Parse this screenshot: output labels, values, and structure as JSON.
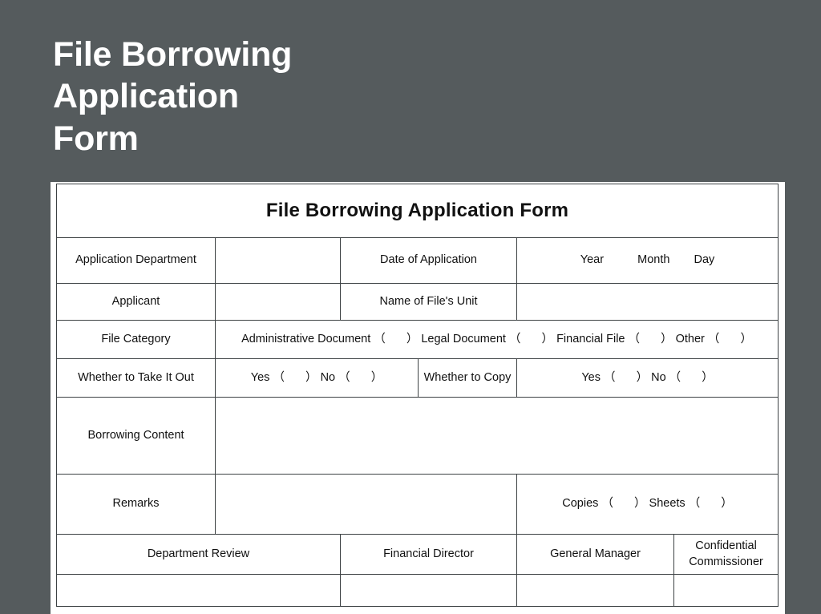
{
  "slide": {
    "heading": "File Borrowing\nApplication\nForm",
    "background_color": "#555b5d",
    "heading_color": "#ffffff"
  },
  "form": {
    "title": "File Borrowing Application Form",
    "rows": {
      "application_department": {
        "label": "Application Department",
        "value": "",
        "date_label": "Date of Application",
        "date_year": "Year",
        "date_month": "Month",
        "date_day": "Day"
      },
      "applicant": {
        "label": "Applicant",
        "value": "",
        "unit_label": "Name of File's Unit",
        "unit_value": ""
      },
      "file_category": {
        "label": "File Category",
        "option_1": "Administrative Document",
        "option_2": "Legal Document",
        "option_3": "Financial File",
        "option_4": "Other",
        "paren_open": "（",
        "paren_close": "）"
      },
      "take_it_out": {
        "label": "Whether to Take It Out",
        "yes": "Yes",
        "no": "No",
        "paren_open": "（",
        "paren_close": "）"
      },
      "copy": {
        "label": "Whether to Copy",
        "yes": "Yes",
        "no": "No",
        "paren_open": "（",
        "paren_close": "）"
      },
      "borrowing_content": {
        "label": "Borrowing Content",
        "value": ""
      },
      "remarks": {
        "label": "Remarks",
        "value": "",
        "copies_label": "Copies",
        "sheets_label": "Sheets",
        "paren_open": "（",
        "paren_close": "）"
      },
      "signatures": {
        "department_review": "Department Review",
        "financial_director": "Financial Director",
        "general_manager": "General Manager",
        "confidential_commissioner": "Confidential Commissioner",
        "department_review_value": "",
        "financial_director_value": "",
        "general_manager_value": "",
        "confidential_commissioner_value": ""
      }
    }
  }
}
